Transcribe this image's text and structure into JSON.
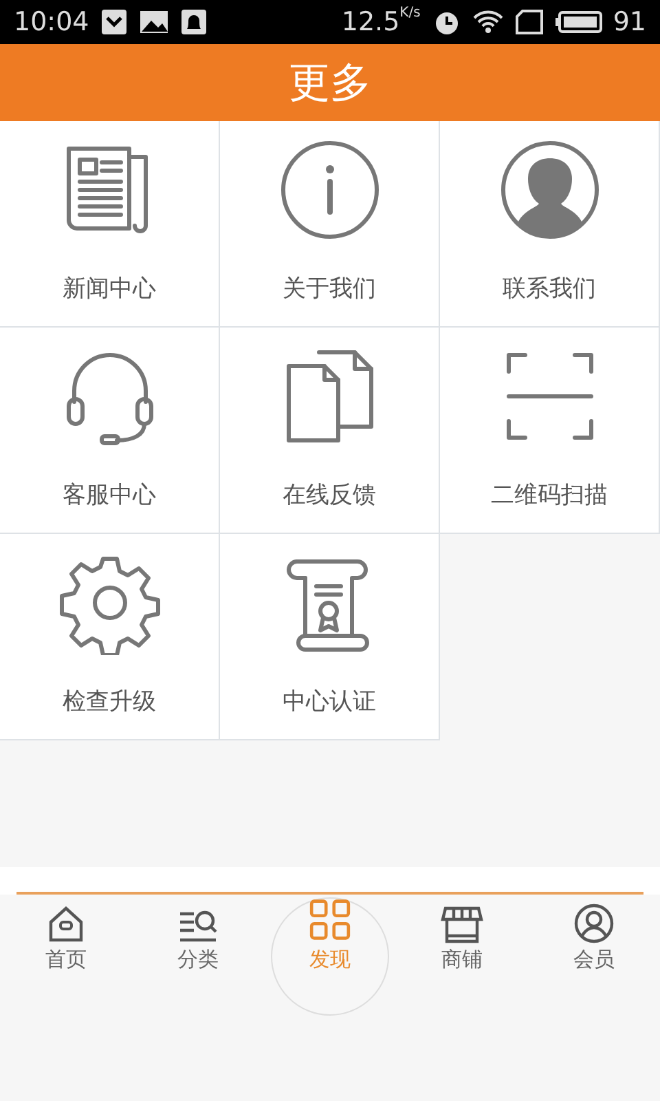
{
  "status_bar": {
    "time": "10:04",
    "speed": "12.5",
    "speed_unit": "K/s",
    "battery": "91"
  },
  "header": {
    "title": "更多"
  },
  "tiles": [
    {
      "kind": "news",
      "label": "新闻中心"
    },
    {
      "kind": "info",
      "label": "关于我们"
    },
    {
      "kind": "person",
      "label": "联系我们"
    },
    {
      "kind": "headset",
      "label": "客服中心"
    },
    {
      "kind": "docs",
      "label": "在线反馈"
    },
    {
      "kind": "scan",
      "label": "二维码扫描"
    },
    {
      "kind": "gear",
      "label": "检查升级"
    },
    {
      "kind": "cert",
      "label": "中心认证"
    }
  ],
  "tab_bar": [
    {
      "kind": "home",
      "label": "首页",
      "selected": false
    },
    {
      "kind": "category",
      "label": "分类",
      "selected": false
    },
    {
      "kind": "discover",
      "label": "发现",
      "selected": true
    },
    {
      "kind": "shop",
      "label": "商铺",
      "selected": false
    },
    {
      "kind": "member",
      "label": "会员",
      "selected": false
    }
  ]
}
